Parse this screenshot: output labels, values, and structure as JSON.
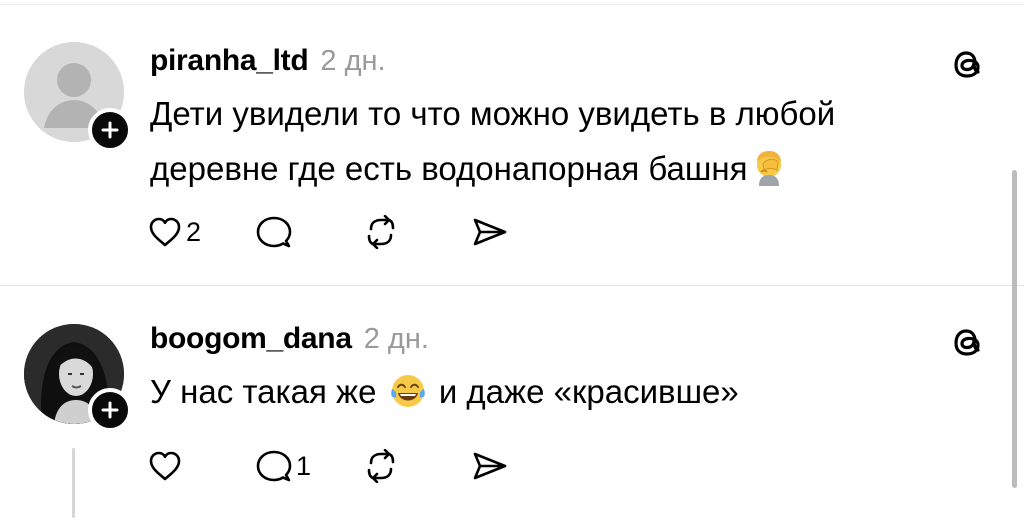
{
  "posts": [
    {
      "username": "piranha_ltd",
      "time": "2 дн.",
      "text": "Дети увидели то что можно увидеть в любой деревне где есть водонапорная башня",
      "emoji": "face-palm",
      "likes": "2",
      "replies": "",
      "avatar": "default-avatar"
    },
    {
      "username": "boogom_dana",
      "time": "2 дн.",
      "text_before": "У нас такая же",
      "text_after": "и даже «красивше»",
      "emoji": "face-with-tears-of-joy",
      "likes": "",
      "replies": "1",
      "avatar": "photo-avatar"
    }
  ],
  "colors": {
    "time": "#9a9a9a",
    "divider": "#e3e3e3",
    "badge": "#0a0a0a"
  }
}
